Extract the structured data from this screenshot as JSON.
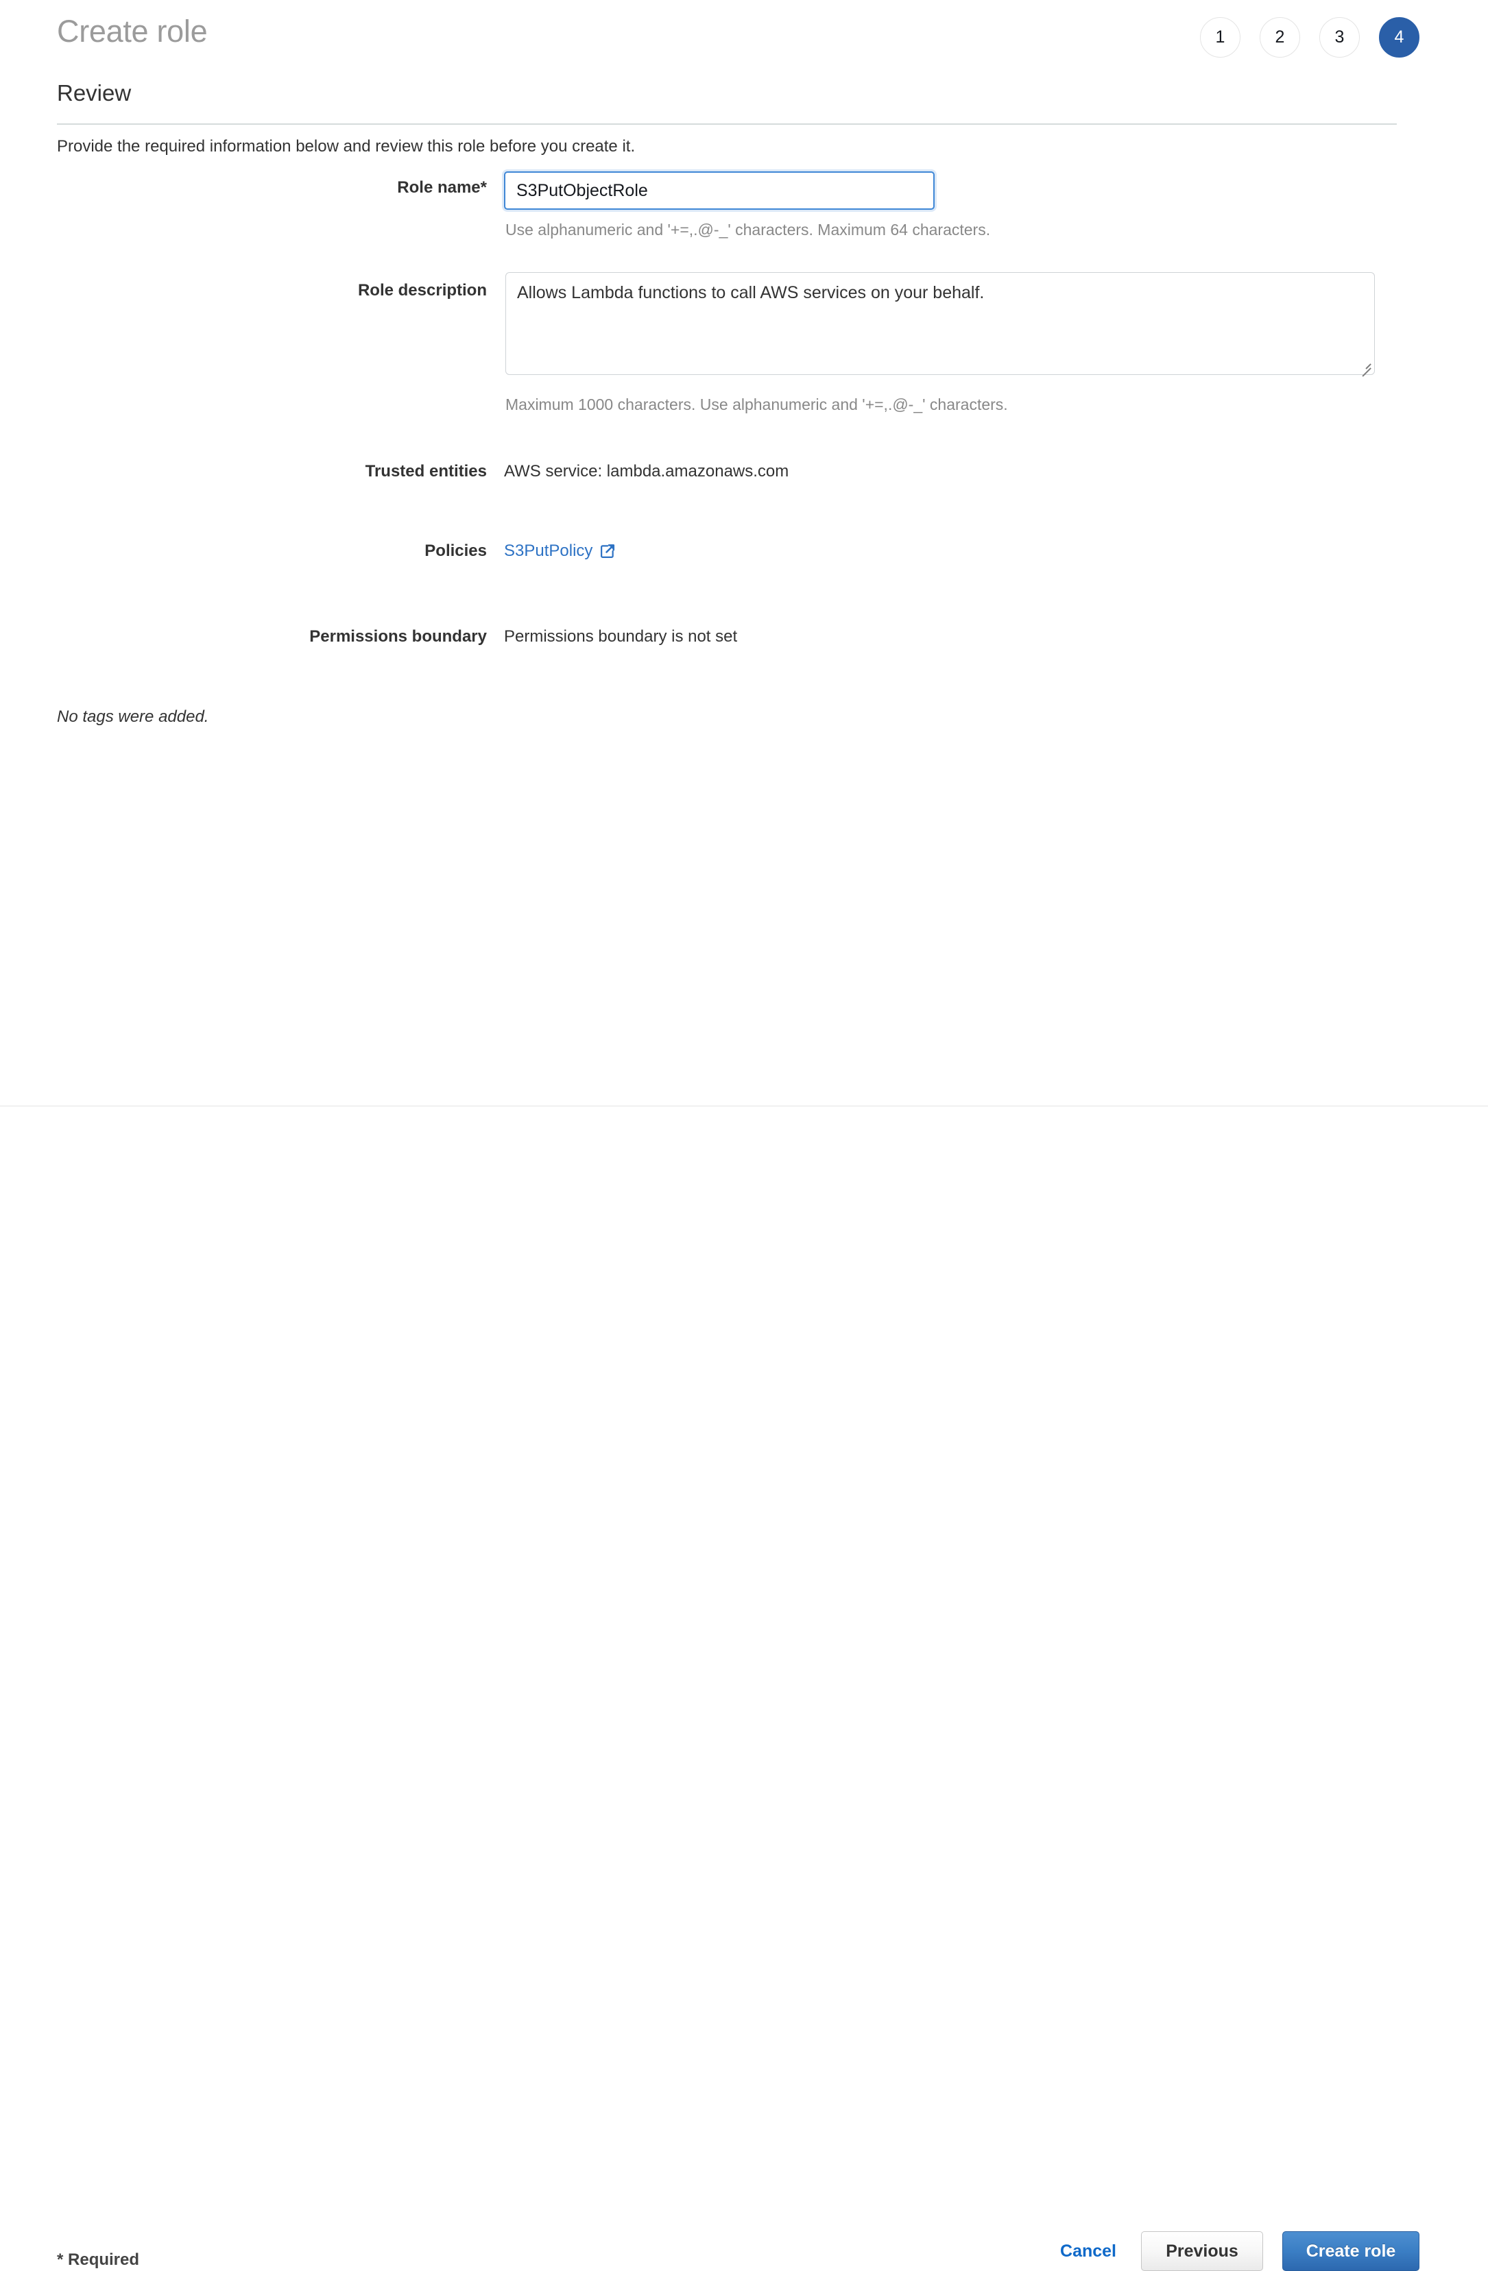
{
  "header": {
    "title": "Create role",
    "steps": [
      {
        "label": "1",
        "active": false
      },
      {
        "label": "2",
        "active": false
      },
      {
        "label": "3",
        "active": false
      },
      {
        "label": "4",
        "active": true
      }
    ]
  },
  "section": {
    "title": "Review",
    "intro": "Provide the required information below and review this role before you create it."
  },
  "form": {
    "role_name": {
      "label": "Role name*",
      "value": "S3PutObjectRole",
      "placeholder": "",
      "hint": "Use alphanumeric and '+=,.@-_' characters. Maximum 64 characters."
    },
    "role_description": {
      "label": "Role description",
      "value": "Allows Lambda functions to call AWS services on your behalf.",
      "placeholder": "",
      "hint": "Maximum 1000 characters. Use alphanumeric and '+=,.@-_' characters."
    },
    "trusted_entities": {
      "label": "Trusted entities",
      "value": "AWS service: lambda.amazonaws.com"
    },
    "policies": {
      "label": "Policies",
      "value": "S3PutPolicy",
      "icon": "external-link-icon"
    },
    "permissions_boundary": {
      "label": "Permissions boundary",
      "value": "Permissions boundary is not set"
    },
    "tags_note": "No tags were added."
  },
  "footer": {
    "required_note": "* Required",
    "cancel_label": "Cancel",
    "previous_label": "Previous",
    "create_label": "Create role"
  },
  "colors": {
    "accent_blue": "#2a5fa8",
    "link_blue": "#2d72c4",
    "primary_button": "#3b7ec4",
    "title_gray": "#9b9b9b",
    "hint_gray": "#888888"
  }
}
